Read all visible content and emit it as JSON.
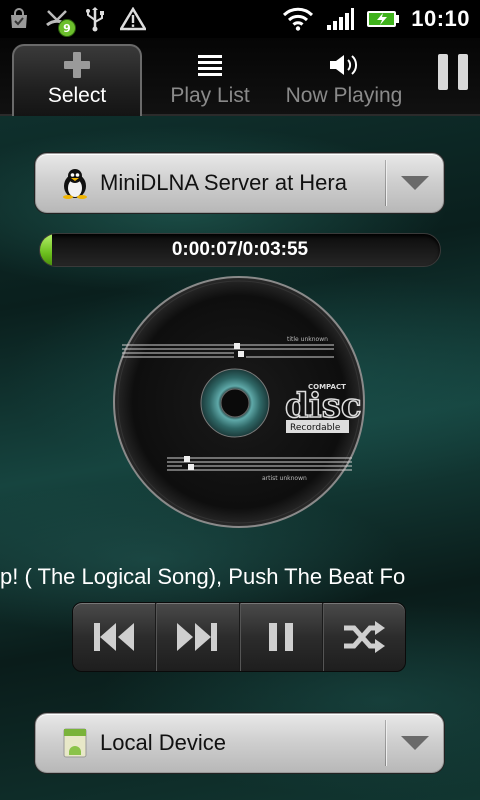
{
  "status_bar": {
    "notification_count": "9",
    "time": "10:10",
    "icons": [
      "shopping-bag-icon",
      "missed-call-icon",
      "usb-icon",
      "warning-icon",
      "wifi-icon",
      "signal-icon",
      "battery-charging-icon"
    ]
  },
  "tabs": [
    {
      "label": "Select",
      "icon": "plus-icon",
      "selected": true
    },
    {
      "label": "Play List",
      "icon": "list-icon",
      "selected": false
    },
    {
      "label": "Now Playing",
      "icon": "speaker-icon",
      "selected": false
    }
  ],
  "top_pause": {
    "icon": "pause-icon"
  },
  "server_select": {
    "label": "MiniDLNA Server at Hera",
    "icon": "linux-penguin-icon"
  },
  "playback": {
    "position_text": "0:00:07/0:03:55",
    "progress_fraction": 0.03
  },
  "album_art": {
    "icon": "compact-disc-icon",
    "disc_label_top": "COMPACT",
    "disc_label_main": "disc",
    "disc_label_sub": "Recordable",
    "title_text": "title unknown",
    "artist_text": "artist unknown"
  },
  "now_playing_title": "p! ( The Logical Song), Push The Beat Fo",
  "controls": [
    {
      "name": "previous-button",
      "icon": "skip-previous-icon"
    },
    {
      "name": "next-button",
      "icon": "skip-next-icon"
    },
    {
      "name": "pause-button",
      "icon": "pause-icon"
    },
    {
      "name": "shuffle-button",
      "icon": "shuffle-icon"
    }
  ],
  "device_select": {
    "label": "Local Device",
    "icon": "android-device-icon"
  },
  "colors": {
    "accent_green": "#6cbf1e",
    "badge_green": "#6cbf2c",
    "background": "#0b1b19"
  }
}
